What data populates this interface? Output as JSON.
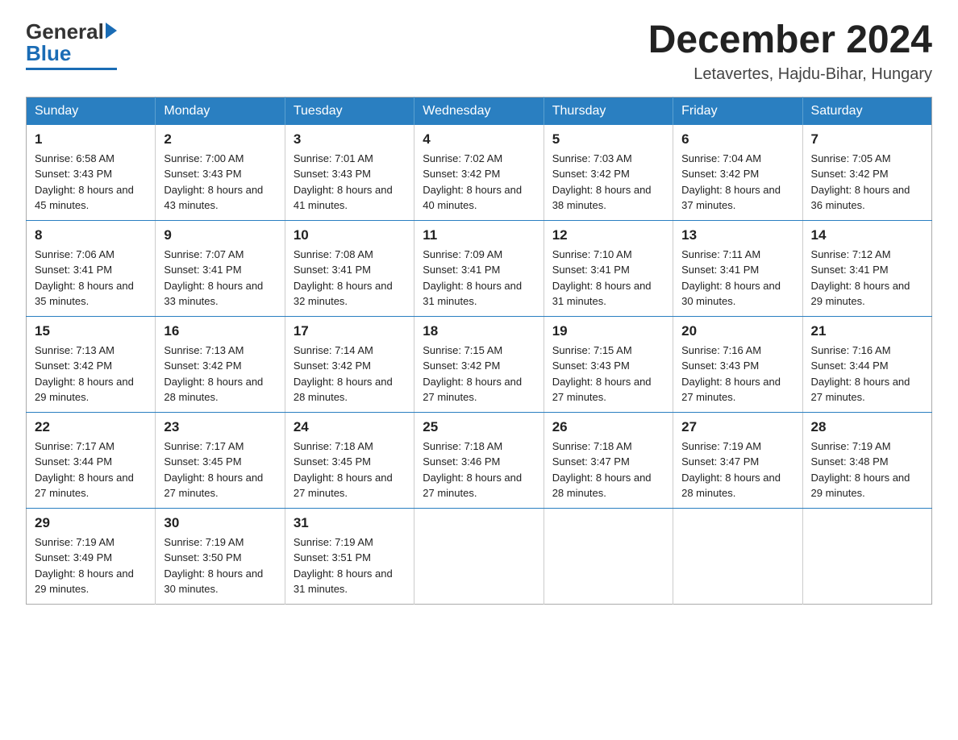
{
  "logo": {
    "general": "General",
    "blue": "Blue"
  },
  "header": {
    "month": "December 2024",
    "location": "Letavertes, Hajdu-Bihar, Hungary"
  },
  "weekdays": [
    "Sunday",
    "Monday",
    "Tuesday",
    "Wednesday",
    "Thursday",
    "Friday",
    "Saturday"
  ],
  "weeks": [
    [
      {
        "day": "1",
        "sunrise": "Sunrise: 6:58 AM",
        "sunset": "Sunset: 3:43 PM",
        "daylight": "Daylight: 8 hours and 45 minutes."
      },
      {
        "day": "2",
        "sunrise": "Sunrise: 7:00 AM",
        "sunset": "Sunset: 3:43 PM",
        "daylight": "Daylight: 8 hours and 43 minutes."
      },
      {
        "day": "3",
        "sunrise": "Sunrise: 7:01 AM",
        "sunset": "Sunset: 3:43 PM",
        "daylight": "Daylight: 8 hours and 41 minutes."
      },
      {
        "day": "4",
        "sunrise": "Sunrise: 7:02 AM",
        "sunset": "Sunset: 3:42 PM",
        "daylight": "Daylight: 8 hours and 40 minutes."
      },
      {
        "day": "5",
        "sunrise": "Sunrise: 7:03 AM",
        "sunset": "Sunset: 3:42 PM",
        "daylight": "Daylight: 8 hours and 38 minutes."
      },
      {
        "day": "6",
        "sunrise": "Sunrise: 7:04 AM",
        "sunset": "Sunset: 3:42 PM",
        "daylight": "Daylight: 8 hours and 37 minutes."
      },
      {
        "day": "7",
        "sunrise": "Sunrise: 7:05 AM",
        "sunset": "Sunset: 3:42 PM",
        "daylight": "Daylight: 8 hours and 36 minutes."
      }
    ],
    [
      {
        "day": "8",
        "sunrise": "Sunrise: 7:06 AM",
        "sunset": "Sunset: 3:41 PM",
        "daylight": "Daylight: 8 hours and 35 minutes."
      },
      {
        "day": "9",
        "sunrise": "Sunrise: 7:07 AM",
        "sunset": "Sunset: 3:41 PM",
        "daylight": "Daylight: 8 hours and 33 minutes."
      },
      {
        "day": "10",
        "sunrise": "Sunrise: 7:08 AM",
        "sunset": "Sunset: 3:41 PM",
        "daylight": "Daylight: 8 hours and 32 minutes."
      },
      {
        "day": "11",
        "sunrise": "Sunrise: 7:09 AM",
        "sunset": "Sunset: 3:41 PM",
        "daylight": "Daylight: 8 hours and 31 minutes."
      },
      {
        "day": "12",
        "sunrise": "Sunrise: 7:10 AM",
        "sunset": "Sunset: 3:41 PM",
        "daylight": "Daylight: 8 hours and 31 minutes."
      },
      {
        "day": "13",
        "sunrise": "Sunrise: 7:11 AM",
        "sunset": "Sunset: 3:41 PM",
        "daylight": "Daylight: 8 hours and 30 minutes."
      },
      {
        "day": "14",
        "sunrise": "Sunrise: 7:12 AM",
        "sunset": "Sunset: 3:41 PM",
        "daylight": "Daylight: 8 hours and 29 minutes."
      }
    ],
    [
      {
        "day": "15",
        "sunrise": "Sunrise: 7:13 AM",
        "sunset": "Sunset: 3:42 PM",
        "daylight": "Daylight: 8 hours and 29 minutes."
      },
      {
        "day": "16",
        "sunrise": "Sunrise: 7:13 AM",
        "sunset": "Sunset: 3:42 PM",
        "daylight": "Daylight: 8 hours and 28 minutes."
      },
      {
        "day": "17",
        "sunrise": "Sunrise: 7:14 AM",
        "sunset": "Sunset: 3:42 PM",
        "daylight": "Daylight: 8 hours and 28 minutes."
      },
      {
        "day": "18",
        "sunrise": "Sunrise: 7:15 AM",
        "sunset": "Sunset: 3:42 PM",
        "daylight": "Daylight: 8 hours and 27 minutes."
      },
      {
        "day": "19",
        "sunrise": "Sunrise: 7:15 AM",
        "sunset": "Sunset: 3:43 PM",
        "daylight": "Daylight: 8 hours and 27 minutes."
      },
      {
        "day": "20",
        "sunrise": "Sunrise: 7:16 AM",
        "sunset": "Sunset: 3:43 PM",
        "daylight": "Daylight: 8 hours and 27 minutes."
      },
      {
        "day": "21",
        "sunrise": "Sunrise: 7:16 AM",
        "sunset": "Sunset: 3:44 PM",
        "daylight": "Daylight: 8 hours and 27 minutes."
      }
    ],
    [
      {
        "day": "22",
        "sunrise": "Sunrise: 7:17 AM",
        "sunset": "Sunset: 3:44 PM",
        "daylight": "Daylight: 8 hours and 27 minutes."
      },
      {
        "day": "23",
        "sunrise": "Sunrise: 7:17 AM",
        "sunset": "Sunset: 3:45 PM",
        "daylight": "Daylight: 8 hours and 27 minutes."
      },
      {
        "day": "24",
        "sunrise": "Sunrise: 7:18 AM",
        "sunset": "Sunset: 3:45 PM",
        "daylight": "Daylight: 8 hours and 27 minutes."
      },
      {
        "day": "25",
        "sunrise": "Sunrise: 7:18 AM",
        "sunset": "Sunset: 3:46 PM",
        "daylight": "Daylight: 8 hours and 27 minutes."
      },
      {
        "day": "26",
        "sunrise": "Sunrise: 7:18 AM",
        "sunset": "Sunset: 3:47 PM",
        "daylight": "Daylight: 8 hours and 28 minutes."
      },
      {
        "day": "27",
        "sunrise": "Sunrise: 7:19 AM",
        "sunset": "Sunset: 3:47 PM",
        "daylight": "Daylight: 8 hours and 28 minutes."
      },
      {
        "day": "28",
        "sunrise": "Sunrise: 7:19 AM",
        "sunset": "Sunset: 3:48 PM",
        "daylight": "Daylight: 8 hours and 29 minutes."
      }
    ],
    [
      {
        "day": "29",
        "sunrise": "Sunrise: 7:19 AM",
        "sunset": "Sunset: 3:49 PM",
        "daylight": "Daylight: 8 hours and 29 minutes."
      },
      {
        "day": "30",
        "sunrise": "Sunrise: 7:19 AM",
        "sunset": "Sunset: 3:50 PM",
        "daylight": "Daylight: 8 hours and 30 minutes."
      },
      {
        "day": "31",
        "sunrise": "Sunrise: 7:19 AM",
        "sunset": "Sunset: 3:51 PM",
        "daylight": "Daylight: 8 hours and 31 minutes."
      },
      null,
      null,
      null,
      null
    ]
  ]
}
